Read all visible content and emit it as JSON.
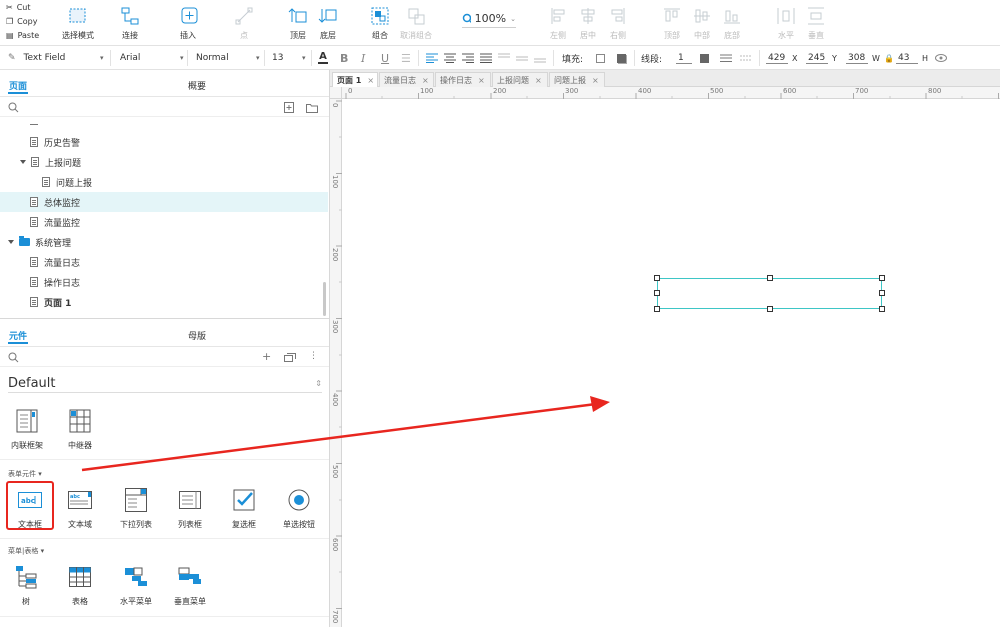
{
  "clipboard": {
    "cut": "Cut",
    "copy": "Copy",
    "paste": "Paste"
  },
  "toolbar": {
    "select_mode": "选择模式",
    "connect": "连接",
    "insert": "插入",
    "point": "点",
    "front": "顶层",
    "back": "底层",
    "group": "组合",
    "ungroup": "取消组合",
    "zoom": "100%",
    "align_left": "左侧",
    "align_center": "居中",
    "align_right": "右侧",
    "align_top": "顶部",
    "align_middle": "中部",
    "align_bottom": "底部",
    "distribute_h": "水平",
    "distribute_v": "垂直"
  },
  "style_bar": {
    "widget_style": "Text Field",
    "font": "Arial",
    "weight": "Normal",
    "size": "13",
    "fill_label": "填充:",
    "line_label": "线段:",
    "line_width": "1",
    "x": "429",
    "x_label": "X",
    "y": "245",
    "y_label": "Y",
    "w": "308",
    "w_label": "W",
    "h": "43",
    "h_label": "H"
  },
  "pages_panel": {
    "tab_pages": "页面",
    "tab_outline": "概要",
    "items": [
      {
        "label": "历史告警",
        "type": "page"
      },
      {
        "label": "上报问题",
        "type": "page"
      },
      {
        "label": "问题上报",
        "type": "page"
      },
      {
        "label": "总体监控",
        "type": "page"
      },
      {
        "label": "流量监控",
        "type": "page"
      },
      {
        "label": "系统管理",
        "type": "folder"
      },
      {
        "label": "流量日志",
        "type": "page"
      },
      {
        "label": "操作日志",
        "type": "page"
      },
      {
        "label": "页面 1",
        "type": "page"
      }
    ]
  },
  "widgets_panel": {
    "tab_widgets": "元件",
    "tab_masters": "母版",
    "library": "Default",
    "section_form": "表单元件 ▾",
    "section_menu": "菜单|表格 ▾",
    "top_widgets": [
      "内联框架",
      "中继器"
    ],
    "form_widgets": [
      "文本框",
      "文本域",
      "下拉列表",
      "列表框",
      "复选框",
      "单选按钮"
    ],
    "menu_widgets": [
      "树",
      "表格",
      "水平菜单",
      "垂直菜单"
    ]
  },
  "doc_tabs": [
    "页面 1",
    "流量日志",
    "操作日志",
    "上报问题",
    "问题上报"
  ],
  "ruler_h": [
    "0",
    "100",
    "200",
    "300",
    "400",
    "500",
    "600",
    "700",
    "800"
  ],
  "ruler_v": [
    "0",
    "100",
    "200",
    "300",
    "400",
    "500",
    "600",
    "700"
  ],
  "colors": {
    "accent": "#1b8fd7",
    "selection": "#3ec6c6",
    "arrow": "#e8261f"
  }
}
